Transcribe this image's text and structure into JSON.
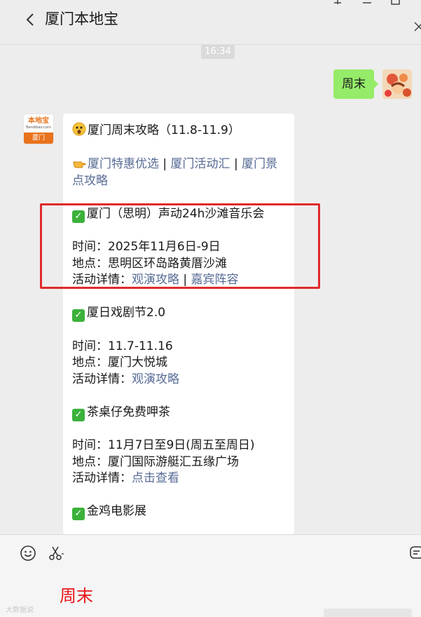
{
  "header": {
    "title": "厦门本地宝"
  },
  "timestamp": "16:34",
  "my_message": {
    "text": "周末"
  },
  "official_avatar": {
    "brand": "本地宝",
    "url": "Bendibao.com",
    "city": "厦门"
  },
  "article": {
    "heading": "厦门周末攻略（11.8-11.9）",
    "nav_links": [
      "厦门特惠优选",
      "厦门活动汇",
      "厦门景点攻略"
    ],
    "separator": " | ",
    "detail_label": "活动详情：",
    "events": [
      {
        "title": "厦门（思明）声动24h沙滩音乐会",
        "time": "时间：2025年11月6日-9日",
        "place": "地点：思明区环岛路黄厝沙滩",
        "links": [
          "观演攻略",
          "嘉宾阵容"
        ]
      },
      {
        "title": "厦日戏剧节2.0",
        "time": "时间：11.7-11.16",
        "place": "地点：厦门大悦城",
        "links": [
          "观演攻略"
        ]
      },
      {
        "title": "茶桌仔免费呷茶",
        "time": "时间：11月7日至9日(周五至周日)",
        "place": "地点：厦门国际游艇汇五缘广场",
        "links": [
          "点击查看"
        ]
      },
      {
        "title": "金鸡电影展"
      }
    ]
  },
  "input": {
    "value": "周末"
  },
  "watermark": "大数据说",
  "colors": {
    "link": "#576b95",
    "bubble": "#95ec69",
    "highlight_box": "#e02a2a",
    "input_text": "#e8161b"
  },
  "icons": [
    "back-arrow-icon",
    "pin-icon",
    "minimize-icon",
    "maximize-icon",
    "close-icon",
    "emoji-icon",
    "scissors-icon",
    "chat-history-icon"
  ]
}
